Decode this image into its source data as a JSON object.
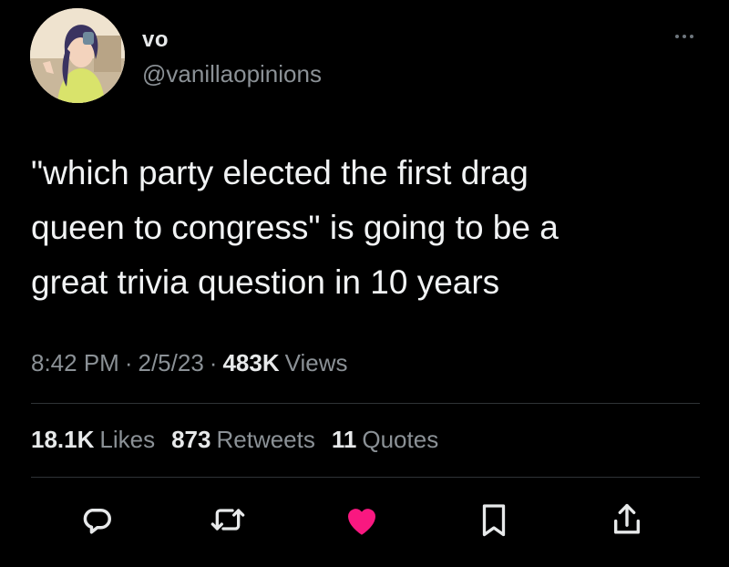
{
  "user": {
    "display_name": "vo",
    "handle": "@vanillaopinions",
    "avatar_icon": "anime-avatar"
  },
  "tweet": {
    "text": "\"which party elected the first drag\nqueen to congress\" is going to be a\ngreat trivia question in 10 years"
  },
  "meta": {
    "time": "8:42 PM",
    "separator": "·",
    "date": "2/5/23",
    "views_count": "483K",
    "views_label": "Views"
  },
  "stats": {
    "likes_count": "18.1K",
    "likes_label": "Likes",
    "retweets_count": "873",
    "retweets_label": "Retweets",
    "quotes_count": "11",
    "quotes_label": "Quotes"
  },
  "actions": [
    {
      "icon": "reply-icon"
    },
    {
      "icon": "retweet-icon"
    },
    {
      "icon": "heart-icon",
      "active": true
    },
    {
      "icon": "bookmark-icon"
    },
    {
      "icon": "share-icon"
    }
  ],
  "colors": {
    "background": "#000000",
    "text_primary": "#e7e9ea",
    "text_secondary": "#8b9196",
    "like_active": "#f91880",
    "divider": "#2f3336"
  }
}
